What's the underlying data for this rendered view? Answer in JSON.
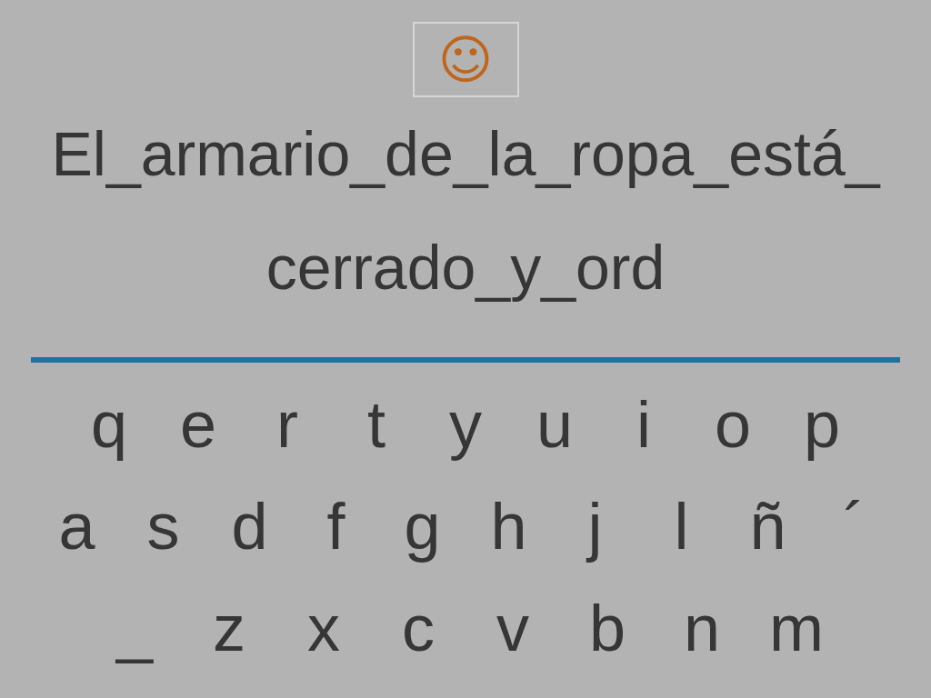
{
  "hint_icon": {
    "glyph": "☺"
  },
  "sentence": {
    "lines": [
      "El_armario_de_la_ropa_está_",
      "cerrado_y_ord"
    ]
  },
  "keyboard": {
    "rows": [
      [
        "q",
        "e",
        "r",
        "t",
        "y",
        "u",
        "i",
        "o",
        "p"
      ],
      [
        "a",
        "s",
        "d",
        "f",
        "g",
        "h",
        "j",
        "l",
        "ñ",
        "´"
      ],
      [
        "_",
        "z",
        "x",
        "c",
        "v",
        "b",
        "n",
        "m"
      ]
    ]
  }
}
